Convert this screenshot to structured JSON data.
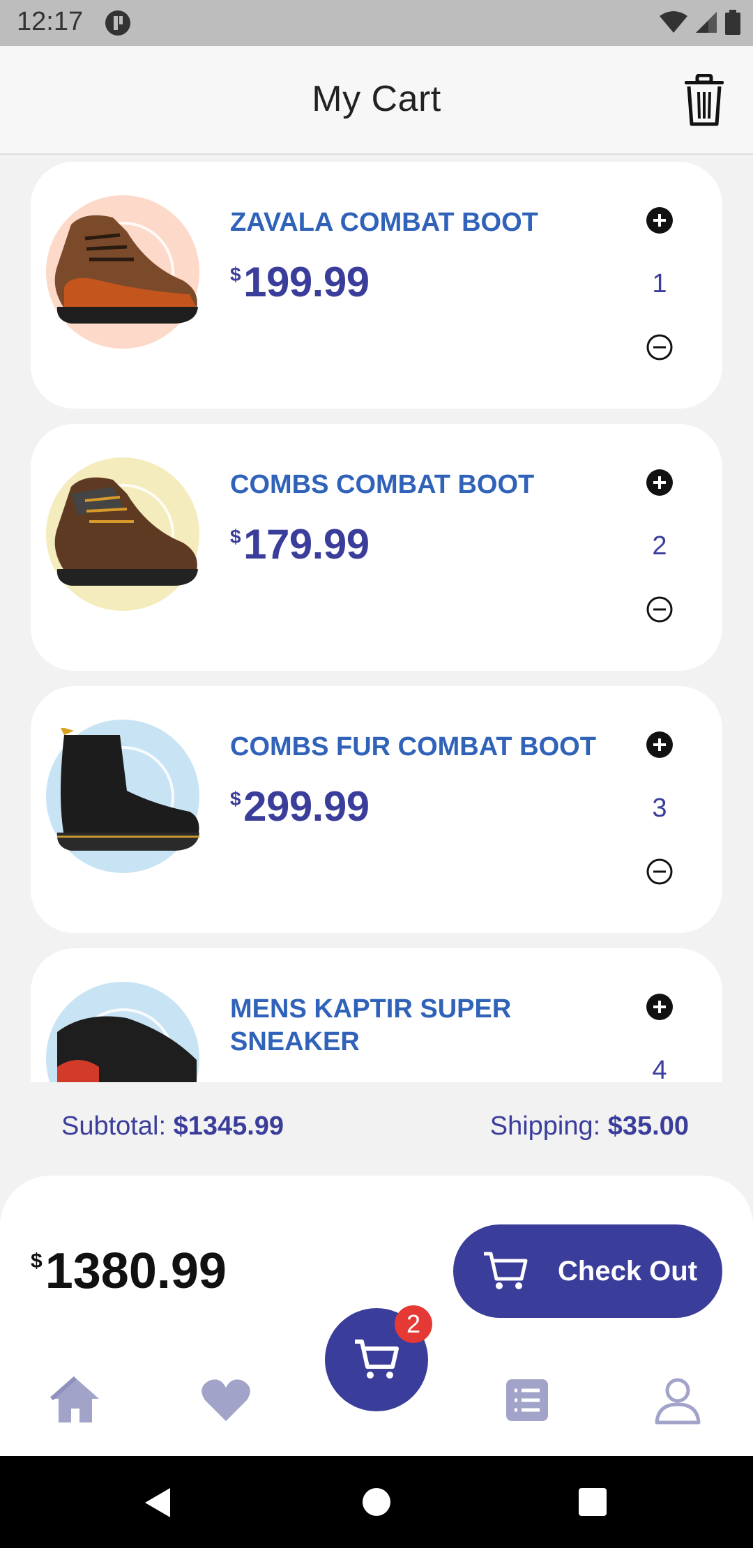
{
  "status_bar": {
    "time": "12:17"
  },
  "app_bar": {
    "title": "My Cart"
  },
  "items": [
    {
      "name": "ZAVALA COMBAT BOOT",
      "currency": "$",
      "price": "199.99",
      "quantity": "1",
      "circle_color": "#fcd9c8"
    },
    {
      "name": "COMBS COMBAT BOOT",
      "currency": "$",
      "price": "179.99",
      "quantity": "2",
      "circle_color": "#f4ecbc"
    },
    {
      "name": "COMBS FUR COMBAT BOOT",
      "currency": "$",
      "price": "299.99",
      "quantity": "3",
      "circle_color": "#c8e4f4"
    },
    {
      "name": "MENS KAPTIR SUPER SNEAKER",
      "currency": "$",
      "price": "",
      "quantity": "4",
      "circle_color": "#c8e4f4"
    }
  ],
  "totals": {
    "subtotal_label": "Subtotal:",
    "subtotal_value": "$1345.99",
    "shipping_label": "Shipping:",
    "shipping_value": "$35.00"
  },
  "checkout": {
    "currency": "$",
    "total": "1380.99",
    "button_label": "Check Out"
  },
  "bottom_nav": {
    "items": [
      "home-icon",
      "heart-icon",
      "cart-icon",
      "list-icon",
      "profile-icon"
    ],
    "cart_badge": "2"
  },
  "colors": {
    "primary": "#3b3d9b",
    "item_name": "#2f62b8",
    "badge": "#e53935",
    "nav_inactive": "#a2a3c8"
  }
}
